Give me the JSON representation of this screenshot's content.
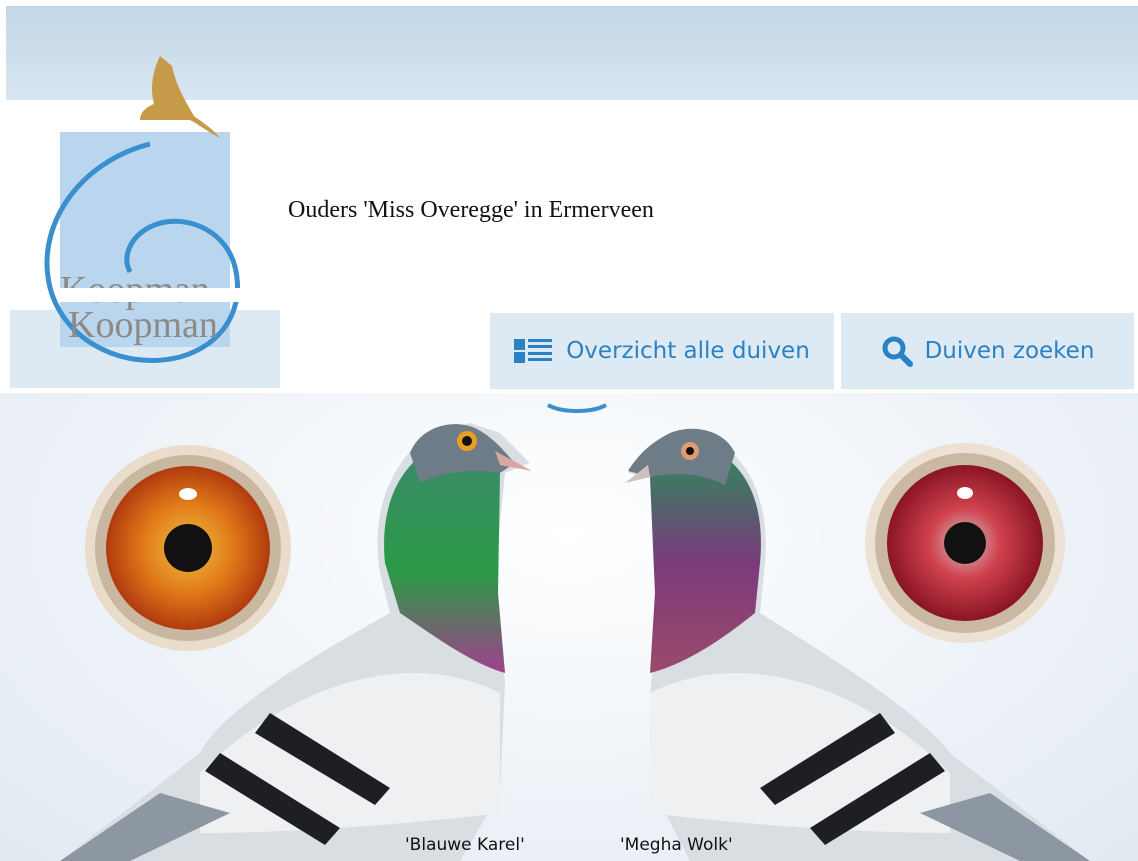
{
  "header": {
    "title": "Ouders 'Miss Overegge' in Ermerveen",
    "logo_text": "Koopman"
  },
  "nav": {
    "overview_label": "Overzicht alle duiven",
    "overview_icon": "list-icon",
    "search_label": "Duiven zoeken",
    "search_icon": "search-icon"
  },
  "hero": {
    "left_bird_name": "'Blauwe Karel'",
    "right_bird_name": "'Megha Wolk'"
  },
  "colors": {
    "accent": "#2a82c4",
    "button_bg": "#dde9f3",
    "logo_gold": "#c79a4a"
  }
}
